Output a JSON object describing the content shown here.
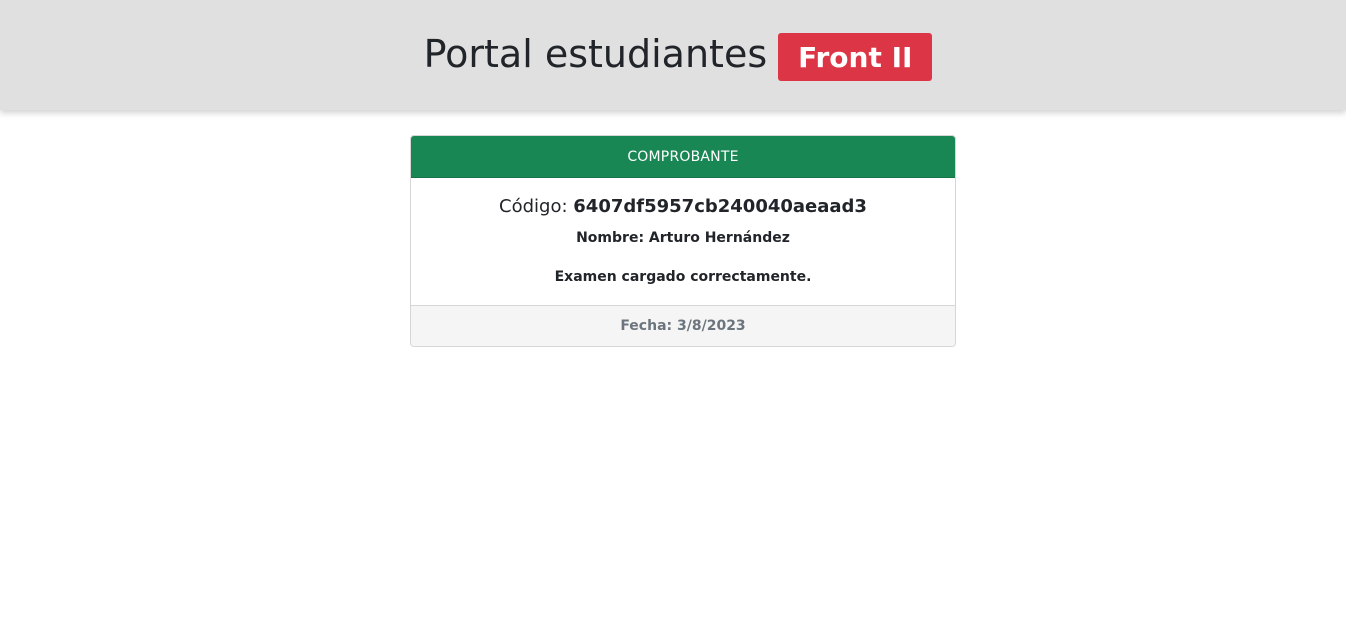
{
  "header": {
    "title": "Portal estudiantes",
    "badge": "Front II",
    "background": "#e0e0e0",
    "badge_color": "#dc3545"
  },
  "receipt": {
    "header_label": "COMPROBANTE",
    "header_color": "#198754",
    "codigo_label": "Código:",
    "codigo_value": "6407df5957cb240040aeaad3",
    "nombre_label": "Nombre:",
    "nombre_value": "Arturo Hernández",
    "message": "Examen cargado correctamente.",
    "fecha_label": "Fecha:",
    "fecha_value": "3/8/2023"
  }
}
